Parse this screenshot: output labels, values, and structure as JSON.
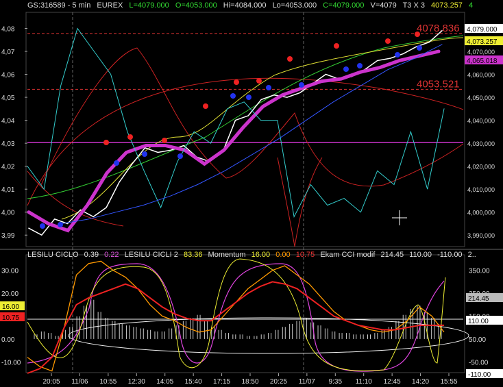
{
  "header": {
    "symbol": "GS:316589 - 5 min",
    "exchange": "EUREX",
    "last": "L=4079.000",
    "open": "O=4053.000",
    "high": "Hi=4084.000",
    "low": "Lo=4053.000",
    "close": "C=4079.000",
    "volume": "V=4079",
    "bars": "T3 X 3",
    "value": "4073.257",
    "count": "4"
  },
  "lower_header": {
    "ind1_name": "LESILU CICLO",
    "ind1_val": "0.39",
    "ind2_val": "0.22",
    "ind2_name": "LESILU CICLI 2",
    "ind2_val2": "83.36",
    "ind3_name": "Momentum",
    "ind3_val1": "16.00",
    "ind3_val2": "0.00",
    "ind3_val3": "10.75",
    "ind4_name": "Ekam CCI modif",
    "ind4_val1": "214.45",
    "ind4_val2": "110.00",
    "ind4_val3": "-110.00",
    "ind4_more": "2.."
  },
  "price_annotations": {
    "level_high": "4078.836",
    "level_low": "4053.521"
  },
  "price_badges": {
    "last": "4,079.000",
    "avg": "4,073.257",
    "mag": "4,065.018"
  },
  "lower_badges": {
    "left_yellow": "16.00",
    "left_red": "10.75",
    "right_gray": "214.45",
    "right_110": "110.00",
    "right_neg110": "-110.00"
  },
  "chart_data": [
    {
      "type": "line",
      "title": "",
      "x_ticks": [
        "20:05",
        "11/06",
        "10:55",
        "12:30",
        "14:05",
        "15:40",
        "17:15",
        "18:50",
        "20:25",
        "11/07",
        "9:35",
        "11:10",
        "12:45",
        "14:20",
        "15:55"
      ],
      "y_ticks_left": [
        "4,08",
        "4,07",
        "4,06",
        "4,05",
        "4,04",
        "4,03",
        "4,02",
        "4,01",
        "4,00",
        "3,99"
      ],
      "y_ticks_right": [
        "4,070,000",
        "4,060,000",
        "4,050,000",
        "4,040,000",
        "4,030,000",
        "4,020,000",
        "4,010,000",
        "4,000,000",
        "3,990,000"
      ],
      "ylim": [
        3.985,
        4.087
      ],
      "series": [
        {
          "role": "price",
          "color": "#ffffff",
          "values": [
            3.993,
            3.99,
            3.997,
            3.995,
            4.001,
            3.998,
            4.002,
            4.013,
            4.021,
            4.028,
            4.026,
            4.027,
            4.029,
            4.024,
            4.022,
            4.026,
            4.04,
            4.042,
            4.049,
            4.051,
            4.05,
            4.052,
            4.056,
            4.06,
            4.058,
            4.059,
            4.062,
            4.066,
            4.067,
            4.069,
            4.072,
            4.074,
            4.079
          ]
        },
        {
          "role": "trend-magenta",
          "color": "#cc33cc",
          "values": [
            4.0,
            3.995,
            3.992,
            4.003,
            4.017,
            4.026,
            4.029,
            4.029,
            4.027,
            4.021,
            4.027,
            4.037,
            4.046,
            4.051,
            4.054,
            4.057,
            4.058,
            4.061,
            4.063,
            4.066,
            4.068,
            4.07
          ]
        },
        {
          "role": "cyan",
          "color": "#33cccc",
          "values": [
            4.02,
            4.01,
            4.055,
            4.08,
            4.07,
            4.06,
            4.035,
            4.018,
            4.002,
            4.022,
            4.035,
            4.03,
            4.045,
            4.048,
            4.04,
            4.04,
            3.998,
            4.012,
            4.003,
            4.006,
            4.0,
            4.018,
            4.012,
            4.035,
            4.01,
            4.045
          ]
        },
        {
          "role": "blue-ma",
          "color": "#3355ff",
          "values": [
            3.995,
            3.997,
            4.0,
            4.003,
            4.007,
            4.012,
            4.018,
            4.025,
            4.032,
            4.04,
            4.048,
            4.055,
            4.062,
            4.067,
            4.073
          ]
        }
      ]
    },
    {
      "type": "line",
      "title": "",
      "yticks_left": [
        "30.00",
        "20.00",
        "10.00",
        "0.00",
        "-10.00"
      ],
      "yticks_right": [
        "350.00",
        "250.00",
        "150.00",
        "50.00",
        "-50.00"
      ],
      "histogram": [
        3,
        5,
        4,
        2,
        6,
        8,
        15,
        22,
        26,
        18,
        14,
        12,
        10,
        9,
        8,
        7,
        6,
        5,
        5,
        7,
        9,
        12,
        14,
        16,
        12,
        8,
        6,
        4,
        3,
        3,
        2,
        2,
        3,
        4,
        6,
        8,
        10,
        12,
        14,
        11,
        9,
        7,
        5,
        4,
        4,
        3,
        3,
        3,
        4,
        6,
        8,
        12,
        16,
        20,
        22,
        18,
        14,
        10
      ],
      "series": [
        {
          "role": "orange",
          "color": "#ff9900",
          "values": [
            -8,
            -12,
            -14,
            5,
            28,
            33,
            34,
            30,
            27,
            22,
            15,
            10,
            8,
            5,
            3,
            4,
            10,
            16,
            22,
            26,
            30,
            32,
            28,
            24,
            18,
            12,
            8,
            6,
            4,
            3,
            4,
            8,
            14,
            10,
            3
          ]
        },
        {
          "role": "red",
          "color": "#ee2222",
          "values": [
            -15,
            -13,
            -8,
            5,
            15,
            18,
            20,
            22,
            24,
            22,
            18,
            14,
            11,
            9,
            8,
            8,
            12,
            16,
            20,
            23,
            25,
            24,
            22,
            18,
            14,
            10,
            8,
            6,
            5,
            4,
            4,
            5,
            6,
            6,
            6
          ]
        }
      ]
    }
  ]
}
